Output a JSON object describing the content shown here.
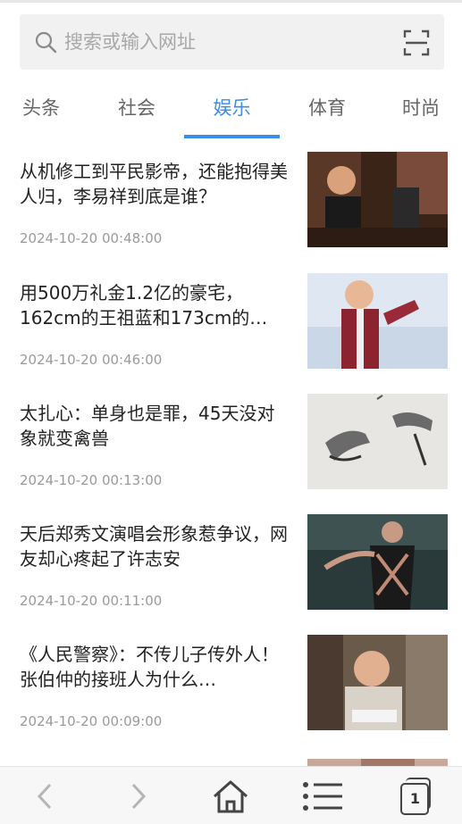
{
  "search": {
    "placeholder": "搜索或输入网址"
  },
  "tabs": [
    {
      "label": "头条",
      "active": false
    },
    {
      "label": "社会",
      "active": false
    },
    {
      "label": "娱乐",
      "active": true
    },
    {
      "label": "体育",
      "active": false
    },
    {
      "label": "时尚",
      "active": false
    }
  ],
  "news": [
    {
      "title": "从机修工到平民影帝，还能抱得美人归，李易祥到底是谁？",
      "time": "2024-10-20 00:48:00"
    },
    {
      "title": "用500万礼金1.2亿的豪宅，162cm的王祖蓝和173cm的…",
      "time": "2024-10-20 00:46:00"
    },
    {
      "title": "太扎心：单身也是罪，45天没对象就变禽兽",
      "time": "2024-10-20 00:13:00"
    },
    {
      "title": "天后郑秀文演唱会形象惹争议，网友却心疼起了许志安",
      "time": "2024-10-20 00:11:00"
    },
    {
      "title": "《人民警察》：不传儿子传外人！张伯仲的接班人为什么…",
      "time": "2024-10-20 00:09:00"
    }
  ],
  "bottom_bar": {
    "tab_count": "1",
    "icons": [
      "back-icon",
      "forward-icon",
      "home-icon",
      "menu-icon",
      "tabs-icon"
    ]
  },
  "colors": {
    "accent": "#3a8ee6",
    "tab_inactive": "#666666",
    "time_text": "#9a9a9a"
  }
}
